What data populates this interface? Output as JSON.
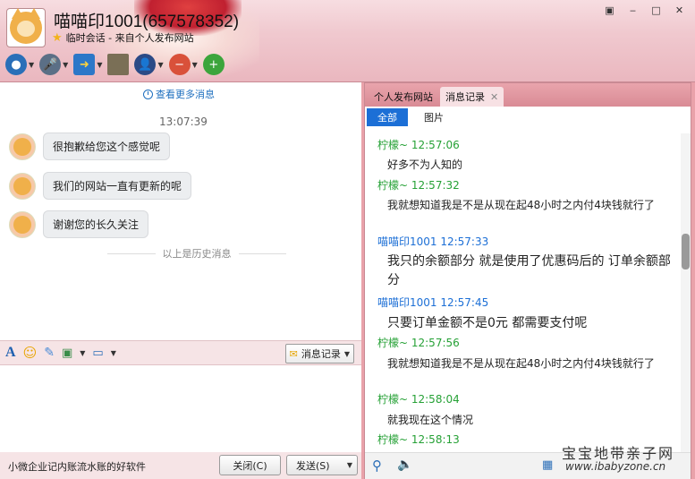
{
  "window": {
    "contact_name": "喵喵印1001(657578352)",
    "subtitle": "临时会话 - 来自个人发布网站",
    "buttons": [
      "▣",
      "‒",
      "□",
      "✕"
    ]
  },
  "chat": {
    "more_link": "查看更多消息",
    "timestamp": "13:07:39",
    "messages": [
      "很抱歉给您这个感觉呢",
      "我们的网站一直有更新的呢",
      "谢谢您的长久关注"
    ],
    "history_divider": "以上是历史消息"
  },
  "input_toolbar": {
    "font_label": "A",
    "history_button": "消息记录"
  },
  "bottom": {
    "ad_text": "小微企业记内账流水账的好软件",
    "close_button": "关闭(C)",
    "send_button": "发送(S)"
  },
  "right_panel": {
    "tabs": [
      "个人发布网站",
      "消息记录"
    ],
    "filters": [
      "全部",
      "图片"
    ],
    "log": [
      {
        "sender": "柠檬~ 12:57:06",
        "color": "g",
        "text": "好多不为人知的",
        "big": false
      },
      {
        "sender": "柠檬~ 12:57:32",
        "color": "g",
        "text": "我就想知道我是不是从现在起48小时之内付4块钱就行了",
        "big": false
      },
      {
        "sender": "喵喵印1001 12:57:33",
        "color": "b",
        "text": "我只的余额部分 就是使用了优惠码后的 订单余额部分",
        "big": true
      },
      {
        "sender": "喵喵印1001 12:57:45",
        "color": "b",
        "text": "只要订单金额不是0元 都需要支付呢",
        "big": true
      },
      {
        "sender": "柠檬~ 12:57:56",
        "color": "g",
        "text": "我就想知道我是不是从现在起48小时之内付4块钱就行了",
        "big": false
      },
      {
        "sender": "柠檬~ 12:58:04",
        "color": "g",
        "text": "就我现在这个情况",
        "big": false
      },
      {
        "sender": "柠檬~ 12:58:13",
        "color": "g",
        "text": "",
        "big": false
      }
    ]
  },
  "watermark": {
    "line1": "宝宝地带亲子网",
    "line2": "www.ibabyzone.cn"
  }
}
